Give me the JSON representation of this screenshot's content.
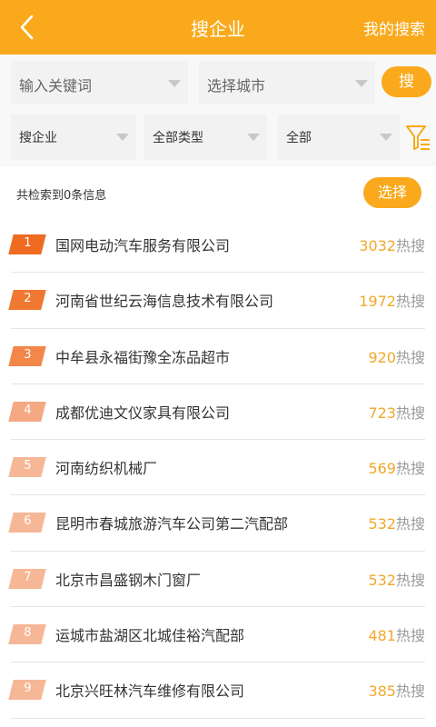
{
  "header": {
    "title": "搜企业",
    "right_link": "我的搜索",
    "background": "#f9a91b"
  },
  "search": {
    "keyword_placeholder": "输入关键词",
    "city_select": "选择城市",
    "search_button": "搜"
  },
  "filters": {
    "type": "搜企业",
    "category": "全部类型",
    "scope": "全部"
  },
  "results": {
    "summary": "共检索到0条信息",
    "select_button": "选择"
  },
  "hot_suffix": "热搜",
  "list": [
    {
      "rank": "1",
      "name": "国网电动汽车服务有限公司",
      "count": "3032",
      "color": "#ef6b21"
    },
    {
      "rank": "2",
      "name": "河南省世纪云海信息技术有限公司",
      "count": "1972",
      "color": "#f07830"
    },
    {
      "rank": "3",
      "name": "中牟县永福街豫全冻品超市",
      "count": "920",
      "color": "#f3874a"
    },
    {
      "rank": "4",
      "name": "成都优迪文仪家具有限公司",
      "count": "723",
      "color": "#f5a983"
    },
    {
      "rank": "5",
      "name": "河南纺织机械厂",
      "count": "569",
      "color": "#f6b796"
    },
    {
      "rank": "6",
      "name": "昆明市春城旅游汽车公司第二汽配部",
      "count": "532",
      "color": "#f6b796"
    },
    {
      "rank": "7",
      "name": "北京市昌盛钢木门窗厂",
      "count": "532",
      "color": "#f6b796"
    },
    {
      "rank": "8",
      "name": "运城市盐湖区北城佳裕汽配部",
      "count": "481",
      "color": "#f6b796"
    },
    {
      "rank": "9",
      "name": "北京兴旺林汽车维修有限公司",
      "count": "385",
      "color": "#f6b796"
    }
  ]
}
